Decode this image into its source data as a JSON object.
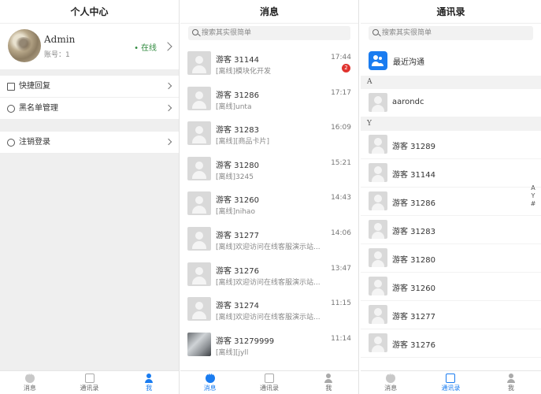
{
  "profile_panel": {
    "title": "个人中心",
    "name": "Admin",
    "account": "账号：1",
    "status": "在线",
    "menu_group1": [
      {
        "label": "快捷回复",
        "icon": "edit-icon"
      },
      {
        "label": "黑名单管理",
        "icon": "block-icon"
      }
    ],
    "menu_group2": [
      {
        "label": "注销登录",
        "icon": "logout-icon"
      }
    ],
    "tabs": [
      "消息",
      "通讯录",
      "我"
    ]
  },
  "message_panel": {
    "title": "消息",
    "search_placeholder": "搜索其实很简单",
    "messages": [
      {
        "name": "游客 31144",
        "time": "17:44",
        "preview": "[离线]模块化开发",
        "badge": "2"
      },
      {
        "name": "游客 31286",
        "time": "17:17",
        "preview": "[离线]unta"
      },
      {
        "name": "游客 31283",
        "time": "16:09",
        "preview": "[离线][商品卡片]"
      },
      {
        "name": "游客 31280",
        "time": "15:21",
        "preview": "[离线]3245"
      },
      {
        "name": "游客 31260",
        "time": "14:43",
        "preview": "[离线]nihao"
      },
      {
        "name": "游客 31277",
        "time": "14:06",
        "preview": "[离线]欢迎访问在线客服演示站..."
      },
      {
        "name": "游客 31276",
        "time": "13:47",
        "preview": "[离线]欢迎访问在线客服演示站..."
      },
      {
        "name": "游客 31274",
        "time": "11:15",
        "preview": "[离线]欢迎访问在线客服演示站..."
      },
      {
        "name": "游客 31279999",
        "time": "11:14",
        "preview": "[离线][jyll"
      }
    ],
    "tabs": [
      "消息",
      "通讯录",
      "我"
    ]
  },
  "contacts_panel": {
    "title": "通讯录",
    "search_placeholder": "搜索其实很简单",
    "recent_label": "最近沟通",
    "sections": [
      {
        "letter": "A",
        "contacts": [
          "aarondc"
        ]
      },
      {
        "letter": "Y",
        "contacts": [
          "游客 31289",
          "游客 31144",
          "游客 31286",
          "游客 31283",
          "游客 31280",
          "游客 31260",
          "游客 31277",
          "游客 31276"
        ]
      }
    ],
    "index": [
      "A",
      "Y",
      "#"
    ],
    "tabs": [
      "消息",
      "通讯录",
      "我"
    ]
  },
  "colors": {
    "accent": "#1a7cf0",
    "online": "#2f8a3e",
    "badge": "#e0332f"
  }
}
